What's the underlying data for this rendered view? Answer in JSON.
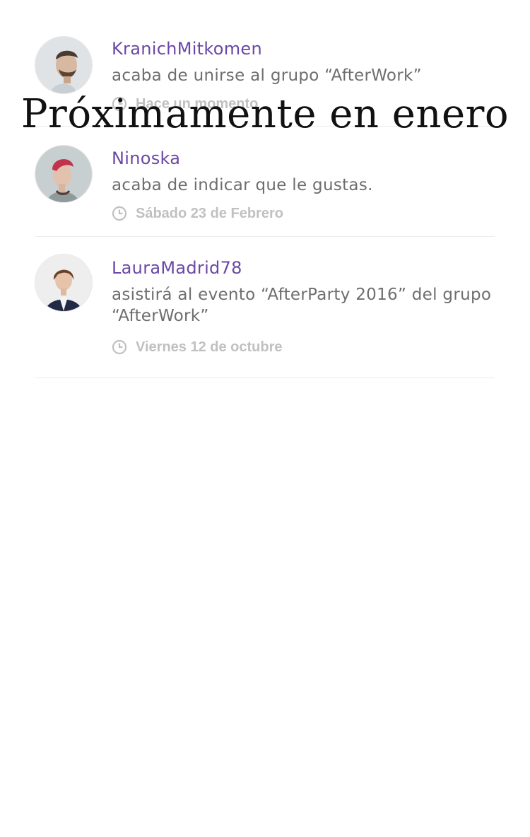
{
  "feed": {
    "items": [
      {
        "username": "KranichMitkomen",
        "action": "acaba de unirse al grupo “AfterWork”",
        "time": "Hace un momento"
      },
      {
        "username": "Ninoska",
        "action": "acaba de indicar que le gustas.",
        "time": "Sábado 23 de Febrero"
      },
      {
        "username": "LauraMadrid78",
        "action": "asistirá al evento “AfterParty 2016” del grupo “AfterWork”",
        "time": "Viernes 12 de octubre"
      }
    ]
  },
  "overlay": {
    "text": "Próximamente en enero"
  },
  "icons": {
    "clock": "clock-icon"
  },
  "colors": {
    "username": "#6b47a6",
    "action_text": "#6e6e6e",
    "timestamp": "#c0c0c0",
    "divider": "#ececec"
  }
}
